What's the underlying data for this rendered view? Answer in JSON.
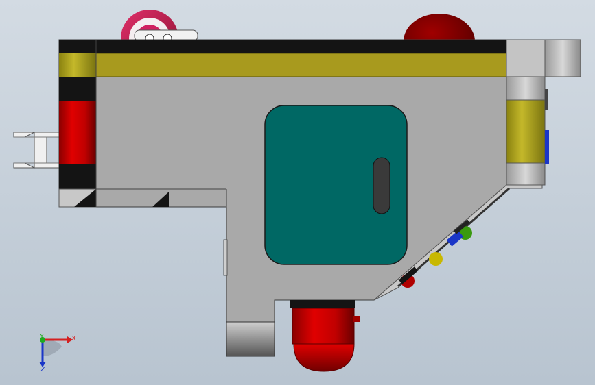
{
  "window": {
    "title": ""
  },
  "triad": {
    "x_label": "X",
    "y_label": "Y",
    "z_label": "Z",
    "x_color": "#d42020",
    "y_color": "#1faa1f",
    "z_color": "#1a36c8"
  },
  "colors": {
    "background_top": "#d3dbe3",
    "background_bottom": "#b8c4d0",
    "body_gray": "#a8a8a8",
    "yellow_band": "#a89a1e",
    "teal_panel": "#006864",
    "red_part": "#c80000",
    "black_part": "#141414"
  }
}
